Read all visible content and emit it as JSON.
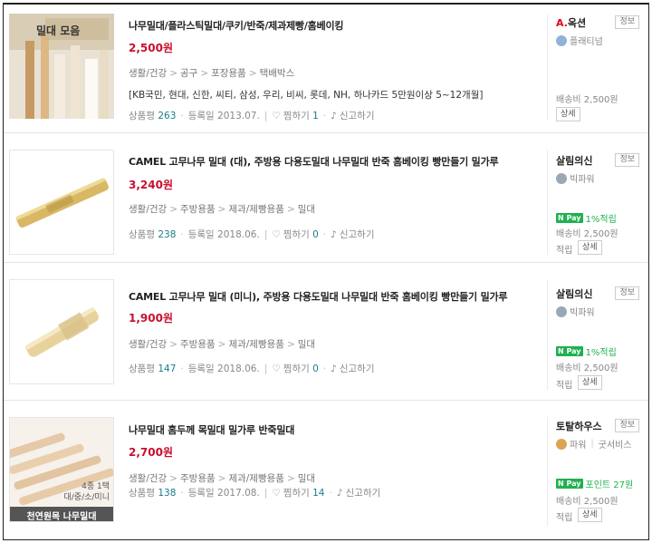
{
  "items": [
    {
      "title": "나무밀대/플라스틱밀대/쿠키/반죽/제과제빵/홈베이킹",
      "price": "2,500원",
      "thumb_label": "밀대 모음",
      "categories": [
        "생활/건강",
        "공구",
        "포장용품",
        "택배박스"
      ],
      "promo": "[KB국민, 현대, 신한, 씨티, 삼성, 우리, 비씨, 롯데, NH, 하나카드 5만원이상 5~12개월]",
      "review_label": "상품평",
      "review_count": "263",
      "reg_label": "등록일",
      "reg_date": "2013.07.",
      "like_label": "찜하기",
      "like_count": "1",
      "report_label": "신고하기",
      "seller_prefix": "A.",
      "seller": "옥션",
      "info_label": "정보",
      "grade": "플래티넘",
      "shipping": "배송비 2,500원",
      "detail_label": "상세"
    },
    {
      "title": "CAMEL 고무나무 밀대 (대), 주방용 다용도밀대 나무밀대 반죽 홈베이킹 빵만들기 밀가루",
      "price": "3,240원",
      "categories": [
        "생활/건강",
        "주방용품",
        "제과/제빵용품",
        "밀대"
      ],
      "review_label": "상품평",
      "review_count": "238",
      "reg_label": "등록일",
      "reg_date": "2018.06.",
      "like_label": "찜하기",
      "like_count": "0",
      "report_label": "신고하기",
      "seller": "살림의신",
      "info_label": "정보",
      "grade": "빅파워",
      "npay_badge": "N Pay",
      "npay_text": "1%적립",
      "shipping": "배송비 2,500원",
      "earn_label": "적립",
      "detail_label": "상세"
    },
    {
      "title": "CAMEL 고무나무 밀대 (미니), 주방용 다용도밀대 나무밀대 반죽 홈베이킹 빵만들기 밀가루",
      "price": "1,900원",
      "categories": [
        "생활/건강",
        "주방용품",
        "제과/제빵용품",
        "밀대"
      ],
      "review_label": "상품평",
      "review_count": "147",
      "reg_label": "등록일",
      "reg_date": "2018.06.",
      "like_label": "찜하기",
      "like_count": "0",
      "report_label": "신고하기",
      "seller": "살림의신",
      "info_label": "정보",
      "grade": "빅파워",
      "npay_badge": "N Pay",
      "npay_text": "1%적립",
      "shipping": "배송비 2,500원",
      "earn_label": "적립",
      "detail_label": "상세"
    },
    {
      "title": "나무밀대 홈두께 목밀대 밀가루 반죽밀대",
      "price": "2,700원",
      "thumb_caption_1": "4종 1택",
      "thumb_caption_2": "대/중/소/미니",
      "thumb_banner": "천연원목 나무밀대",
      "categories": [
        "생활/건강",
        "주방용품",
        "제과/제빵용품",
        "밀대"
      ],
      "review_label": "상품평",
      "review_count": "138",
      "reg_label": "등록일",
      "reg_date": "2017.08.",
      "like_label": "찜하기",
      "like_count": "14",
      "report_label": "신고하기",
      "seller": "토탈하우스",
      "info_label": "정보",
      "grade": "파워",
      "grade_extra": "굿서비스",
      "npay_badge": "N Pay",
      "npay_text": "포인트 27원",
      "shipping": "배송비 2,500원",
      "earn_label": "적립",
      "detail_label": "상세"
    }
  ],
  "colors": {
    "price": "#c8102e",
    "npay": "#1fb14f",
    "review_count": "#1a7c8a",
    "auction_red": "#e60012"
  }
}
